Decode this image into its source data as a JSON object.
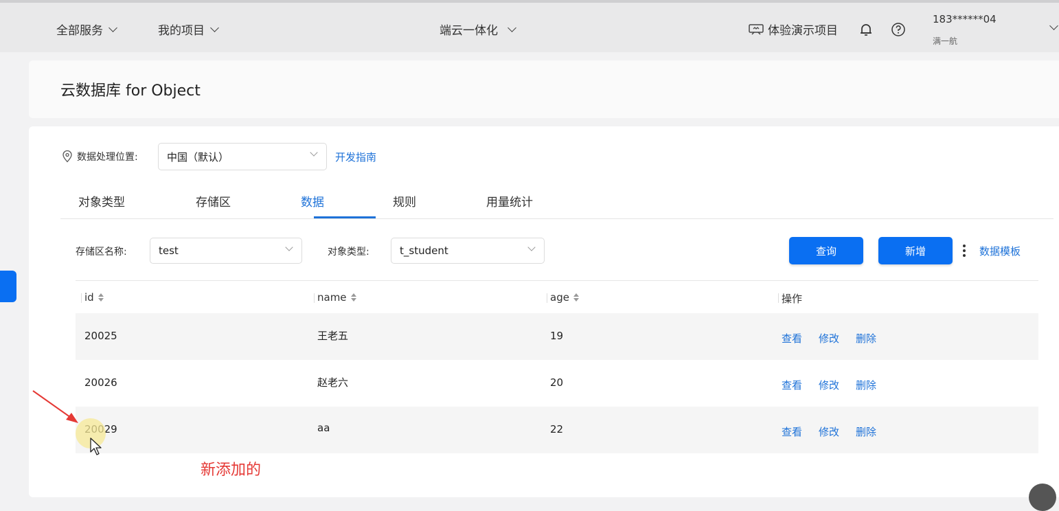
{
  "topbar": {
    "all_services": "全部服务",
    "my_projects": "我的项目",
    "center_menu": "端云一体化",
    "demo_project": "体验演示项目",
    "user_phone": "183******04",
    "user_name": "满一航"
  },
  "page_title": "云数据库 for Object",
  "location": {
    "label": "数据处理位置:",
    "value": "中国（默认）",
    "dev_guide": "开发指南"
  },
  "tabs": [
    "对象类型",
    "存储区",
    "数据",
    "规则",
    "用量统计"
  ],
  "active_tab": "数据",
  "filters": {
    "zone_label": "存储区名称:",
    "zone_value": "test",
    "type_label": "对象类型:",
    "type_value": "t_student"
  },
  "buttons": {
    "query": "查询",
    "add": "新增",
    "template": "数据模板"
  },
  "table": {
    "headers": [
      "id",
      "name",
      "age",
      "操作"
    ],
    "rows": [
      {
        "id": "20025",
        "name": "王老五",
        "age": "19"
      },
      {
        "id": "20026",
        "name": "赵老六",
        "age": "20"
      },
      {
        "id": "20029",
        "name": "aa",
        "age": "22"
      }
    ],
    "actions": [
      "查看",
      "修改",
      "删除"
    ]
  },
  "annotation": "新添加的",
  "colors": {
    "accent": "#0a6ff2",
    "link": "#1e72d8",
    "annotation": "#e53935"
  }
}
